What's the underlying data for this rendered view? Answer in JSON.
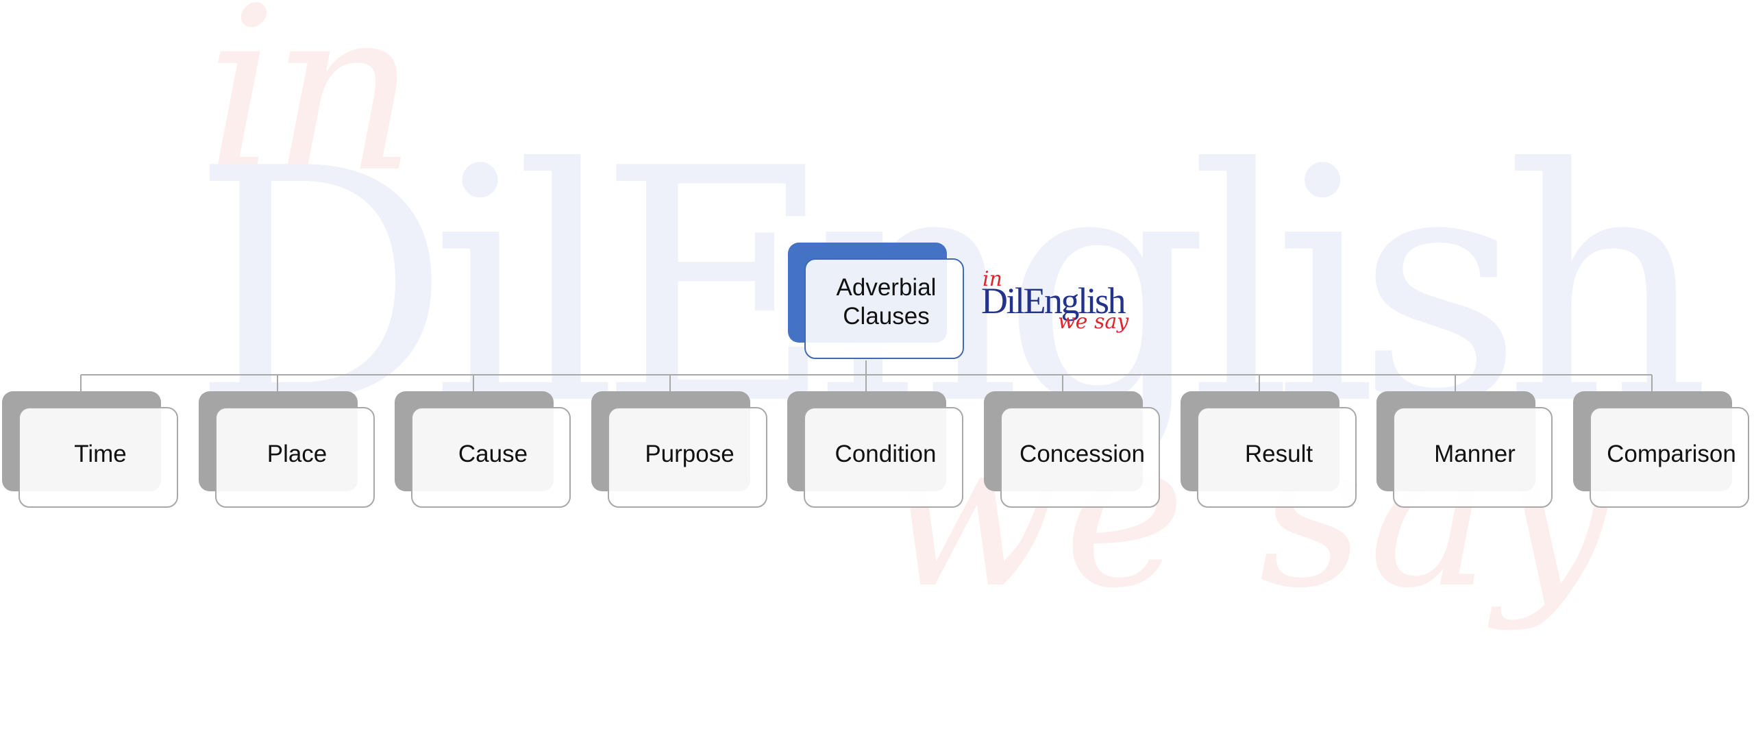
{
  "watermark": {
    "top": "in",
    "brand": "DilEnglish",
    "bottom": "we say"
  },
  "logo": {
    "top": "in",
    "brand": "DilEnglish",
    "bottom": "we say",
    "colors": {
      "brand": "#23338b",
      "accent": "#e0252f"
    }
  },
  "diagram": {
    "root": {
      "label": "Adverbial\nClauses",
      "line1": "Adverbial",
      "line2": "Clauses",
      "color": "#4472c4"
    },
    "children": [
      {
        "label": "Time"
      },
      {
        "label": "Place"
      },
      {
        "label": "Cause"
      },
      {
        "label": "Purpose"
      },
      {
        "label": "Condition"
      },
      {
        "label": "Concession"
      },
      {
        "label": "Result"
      },
      {
        "label": "Manner"
      },
      {
        "label": "Comparison"
      }
    ],
    "child_color": "#a5a5a5",
    "connector_color": "#a8a8a8"
  }
}
